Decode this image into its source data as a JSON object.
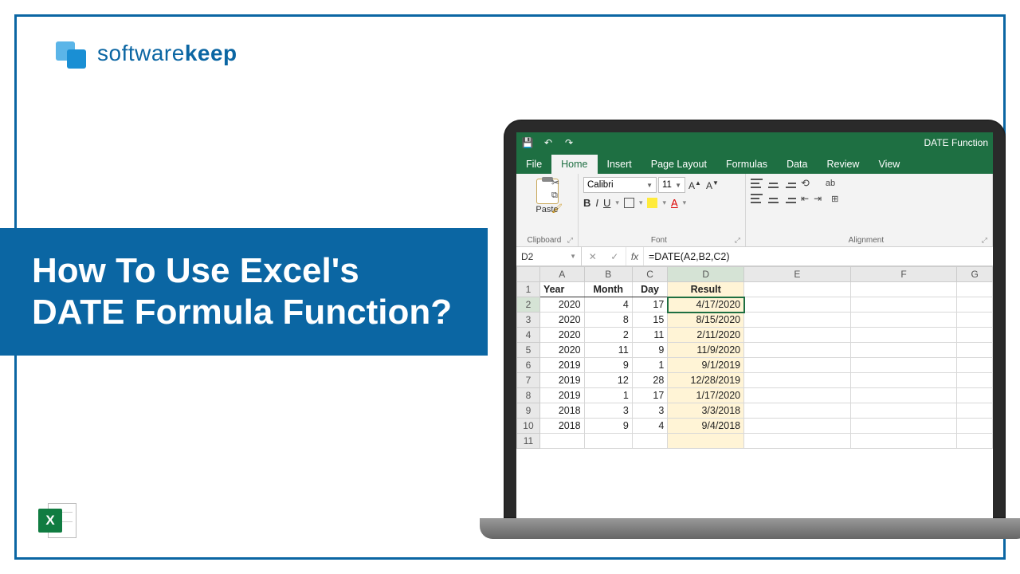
{
  "logo": {
    "part1": "software",
    "part2": "keep"
  },
  "title": "How To Use Excel's DATE Formula Function?",
  "excel_icon_letter": "X",
  "titlebar": {
    "doc": "DATE Function"
  },
  "tabs": [
    "File",
    "Home",
    "Insert",
    "Page Layout",
    "Formulas",
    "Data",
    "Review",
    "View"
  ],
  "active_tab": "Home",
  "ribbon": {
    "clipboard": {
      "paste": "Paste",
      "label": "Clipboard"
    },
    "font": {
      "name": "Calibri",
      "size": "11",
      "label": "Font"
    },
    "alignment": {
      "label": "Alignment"
    }
  },
  "namebox": "D2",
  "formula": "=DATE(A2,B2,C2)",
  "columns": [
    "A",
    "B",
    "C",
    "D",
    "E",
    "F",
    "G"
  ],
  "rows_shown": 11,
  "headers": {
    "A": "Year",
    "B": "Month",
    "C": "Day",
    "D": "Result"
  },
  "data": [
    {
      "year": 2020,
      "month": 4,
      "day": 17,
      "result": "4/17/2020"
    },
    {
      "year": 2020,
      "month": 8,
      "day": 15,
      "result": "8/15/2020"
    },
    {
      "year": 2020,
      "month": 2,
      "day": 11,
      "result": "2/11/2020"
    },
    {
      "year": 2020,
      "month": 11,
      "day": 9,
      "result": "11/9/2020"
    },
    {
      "year": 2019,
      "month": 9,
      "day": 1,
      "result": "9/1/2019"
    },
    {
      "year": 2019,
      "month": 12,
      "day": 28,
      "result": "12/28/2019"
    },
    {
      "year": 2019,
      "month": 1,
      "day": 17,
      "result": "1/17/2020"
    },
    {
      "year": 2018,
      "month": 3,
      "day": 3,
      "result": "3/3/2018"
    },
    {
      "year": 2018,
      "month": 9,
      "day": 4,
      "result": "9/4/2018"
    }
  ],
  "selected_cell": "D2"
}
